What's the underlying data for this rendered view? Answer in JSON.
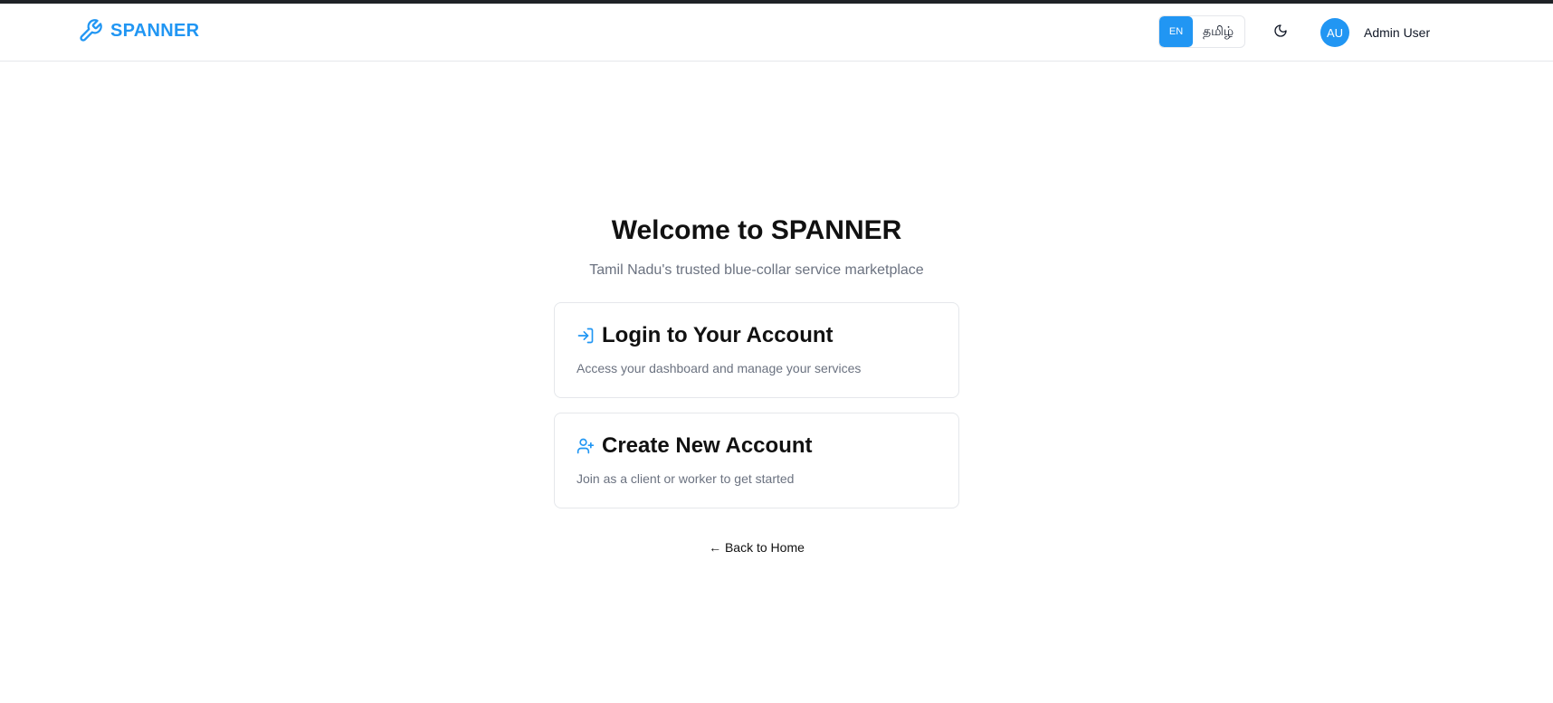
{
  "header": {
    "brand": "SPANNER",
    "lang": {
      "en": "EN",
      "ta": "தமிழ்"
    },
    "user": {
      "initials": "AU",
      "name": "Admin User"
    }
  },
  "main": {
    "title": "Welcome to SPANNER",
    "subtitle": "Tamil Nadu's trusted blue-collar service marketplace",
    "cards": [
      {
        "title": "Login to Your Account",
        "description": "Access your dashboard and manage your services",
        "icon": "login-icon"
      },
      {
        "title": "Create New Account",
        "description": "Join as a client or worker to get started",
        "icon": "user-plus-icon"
      }
    ],
    "back_link": "← Back to Home"
  },
  "colors": {
    "accent": "#2196f3",
    "text": "#111111",
    "muted": "#6b7280",
    "border": "#e5e7eb",
    "top_strip": "#1f2226"
  }
}
